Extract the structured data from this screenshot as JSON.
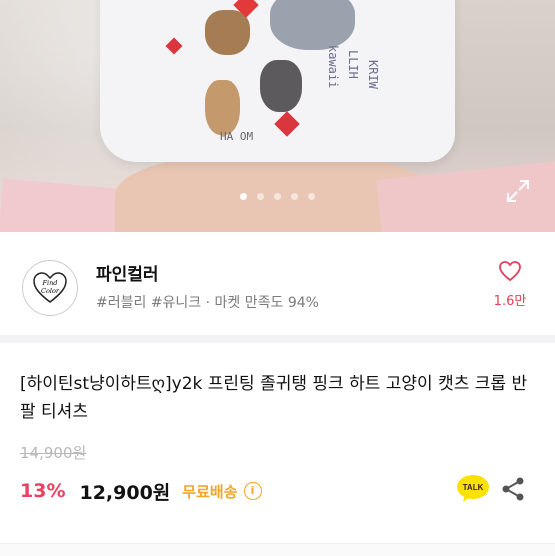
{
  "gallery": {
    "slide_count": 5,
    "active_index": 0,
    "shirt_print_texts": [
      "kawaii",
      "LLIH",
      "KRIW",
      "HA OM"
    ]
  },
  "seller": {
    "name": "파인컬러",
    "tags": "#러블리 #유니크 · 마켓 만족도 94%",
    "like_count": "1.6만",
    "logo_text_line1": "Find",
    "logo_text_line2": "Color"
  },
  "product": {
    "title": "[하이틴st냥이하트ღ]y2k 프린팅 졸귀탱 핑크 하트 고양이 캣츠 크롭 반팔 티셔츠",
    "original_price": "14,900원",
    "discount": "13%",
    "price": "12,900원",
    "shipping": "무료배송",
    "info_symbol": "i",
    "talk_label": "TALK"
  },
  "colors": {
    "accent_red": "#ec3f61",
    "shipping_orange": "#f3a62b",
    "kakao_yellow": "#fae100"
  }
}
